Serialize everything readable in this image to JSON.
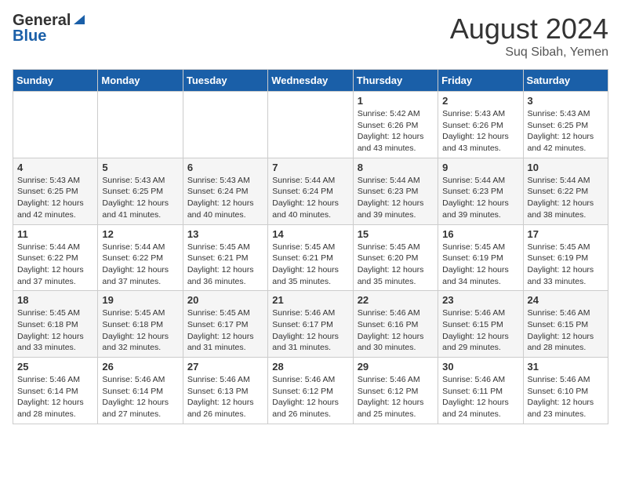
{
  "header": {
    "logo_general": "General",
    "logo_blue": "Blue",
    "month_year": "August 2024",
    "location": "Suq Sibah, Yemen"
  },
  "weekdays": [
    "Sunday",
    "Monday",
    "Tuesday",
    "Wednesday",
    "Thursday",
    "Friday",
    "Saturday"
  ],
  "weeks": [
    [
      {
        "day": "",
        "info": ""
      },
      {
        "day": "",
        "info": ""
      },
      {
        "day": "",
        "info": ""
      },
      {
        "day": "",
        "info": ""
      },
      {
        "day": "1",
        "info": "Sunrise: 5:42 AM\nSunset: 6:26 PM\nDaylight: 12 hours\nand 43 minutes."
      },
      {
        "day": "2",
        "info": "Sunrise: 5:43 AM\nSunset: 6:26 PM\nDaylight: 12 hours\nand 43 minutes."
      },
      {
        "day": "3",
        "info": "Sunrise: 5:43 AM\nSunset: 6:25 PM\nDaylight: 12 hours\nand 42 minutes."
      }
    ],
    [
      {
        "day": "4",
        "info": "Sunrise: 5:43 AM\nSunset: 6:25 PM\nDaylight: 12 hours\nand 42 minutes."
      },
      {
        "day": "5",
        "info": "Sunrise: 5:43 AM\nSunset: 6:25 PM\nDaylight: 12 hours\nand 41 minutes."
      },
      {
        "day": "6",
        "info": "Sunrise: 5:43 AM\nSunset: 6:24 PM\nDaylight: 12 hours\nand 40 minutes."
      },
      {
        "day": "7",
        "info": "Sunrise: 5:44 AM\nSunset: 6:24 PM\nDaylight: 12 hours\nand 40 minutes."
      },
      {
        "day": "8",
        "info": "Sunrise: 5:44 AM\nSunset: 6:23 PM\nDaylight: 12 hours\nand 39 minutes."
      },
      {
        "day": "9",
        "info": "Sunrise: 5:44 AM\nSunset: 6:23 PM\nDaylight: 12 hours\nand 39 minutes."
      },
      {
        "day": "10",
        "info": "Sunrise: 5:44 AM\nSunset: 6:22 PM\nDaylight: 12 hours\nand 38 minutes."
      }
    ],
    [
      {
        "day": "11",
        "info": "Sunrise: 5:44 AM\nSunset: 6:22 PM\nDaylight: 12 hours\nand 37 minutes."
      },
      {
        "day": "12",
        "info": "Sunrise: 5:44 AM\nSunset: 6:22 PM\nDaylight: 12 hours\nand 37 minutes."
      },
      {
        "day": "13",
        "info": "Sunrise: 5:45 AM\nSunset: 6:21 PM\nDaylight: 12 hours\nand 36 minutes."
      },
      {
        "day": "14",
        "info": "Sunrise: 5:45 AM\nSunset: 6:21 PM\nDaylight: 12 hours\nand 35 minutes."
      },
      {
        "day": "15",
        "info": "Sunrise: 5:45 AM\nSunset: 6:20 PM\nDaylight: 12 hours\nand 35 minutes."
      },
      {
        "day": "16",
        "info": "Sunrise: 5:45 AM\nSunset: 6:19 PM\nDaylight: 12 hours\nand 34 minutes."
      },
      {
        "day": "17",
        "info": "Sunrise: 5:45 AM\nSunset: 6:19 PM\nDaylight: 12 hours\nand 33 minutes."
      }
    ],
    [
      {
        "day": "18",
        "info": "Sunrise: 5:45 AM\nSunset: 6:18 PM\nDaylight: 12 hours\nand 33 minutes."
      },
      {
        "day": "19",
        "info": "Sunrise: 5:45 AM\nSunset: 6:18 PM\nDaylight: 12 hours\nand 32 minutes."
      },
      {
        "day": "20",
        "info": "Sunrise: 5:45 AM\nSunset: 6:17 PM\nDaylight: 12 hours\nand 31 minutes."
      },
      {
        "day": "21",
        "info": "Sunrise: 5:46 AM\nSunset: 6:17 PM\nDaylight: 12 hours\nand 31 minutes."
      },
      {
        "day": "22",
        "info": "Sunrise: 5:46 AM\nSunset: 6:16 PM\nDaylight: 12 hours\nand 30 minutes."
      },
      {
        "day": "23",
        "info": "Sunrise: 5:46 AM\nSunset: 6:15 PM\nDaylight: 12 hours\nand 29 minutes."
      },
      {
        "day": "24",
        "info": "Sunrise: 5:46 AM\nSunset: 6:15 PM\nDaylight: 12 hours\nand 28 minutes."
      }
    ],
    [
      {
        "day": "25",
        "info": "Sunrise: 5:46 AM\nSunset: 6:14 PM\nDaylight: 12 hours\nand 28 minutes."
      },
      {
        "day": "26",
        "info": "Sunrise: 5:46 AM\nSunset: 6:14 PM\nDaylight: 12 hours\nand 27 minutes."
      },
      {
        "day": "27",
        "info": "Sunrise: 5:46 AM\nSunset: 6:13 PM\nDaylight: 12 hours\nand 26 minutes."
      },
      {
        "day": "28",
        "info": "Sunrise: 5:46 AM\nSunset: 6:12 PM\nDaylight: 12 hours\nand 26 minutes."
      },
      {
        "day": "29",
        "info": "Sunrise: 5:46 AM\nSunset: 6:12 PM\nDaylight: 12 hours\nand 25 minutes."
      },
      {
        "day": "30",
        "info": "Sunrise: 5:46 AM\nSunset: 6:11 PM\nDaylight: 12 hours\nand 24 minutes."
      },
      {
        "day": "31",
        "info": "Sunrise: 5:46 AM\nSunset: 6:10 PM\nDaylight: 12 hours\nand 23 minutes."
      }
    ]
  ]
}
